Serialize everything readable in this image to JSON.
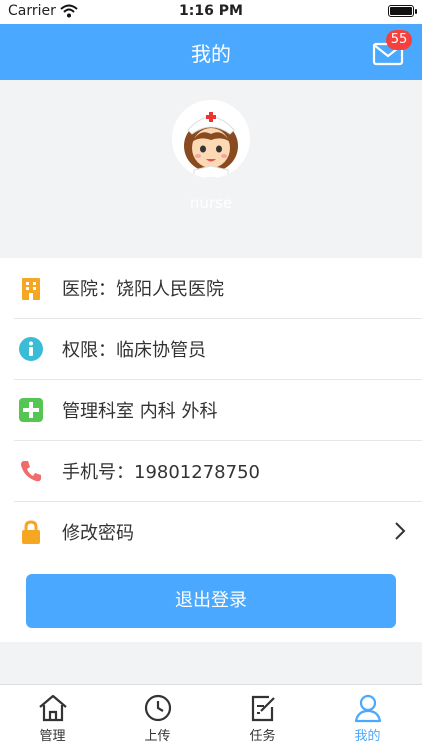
{
  "status_bar": {
    "carrier": "Carrier",
    "time": "1:16 PM"
  },
  "header": {
    "title": "我的",
    "unread_count": "55"
  },
  "profile": {
    "username": "nurse"
  },
  "info_rows": [
    {
      "label": "医院：饶阳人民医院",
      "icon": "hospital-building-icon",
      "color": "#f5a623"
    },
    {
      "label": "权限：临床协管员",
      "icon": "info-icon",
      "color": "#3bbcd6"
    },
    {
      "label": "管理科室 内科 外科",
      "icon": "plus-icon",
      "color": "#55c653"
    },
    {
      "label": "手机号：19801278750",
      "icon": "phone-icon",
      "color": "#f06b6b"
    },
    {
      "label": "修改密码",
      "icon": "lock-icon",
      "color": "#f5a623"
    }
  ],
  "logout": {
    "label": "退出登录"
  },
  "tabs": [
    {
      "label": "管理",
      "icon": "home-icon"
    },
    {
      "label": "上传",
      "icon": "clock-icon"
    },
    {
      "label": "任务",
      "icon": "edit-icon"
    },
    {
      "label": "我的",
      "icon": "user-icon",
      "active": true
    }
  ],
  "colors": {
    "primary": "#4aa8ff",
    "badge": "#f4413d",
    "background": "#f2f3f5"
  }
}
